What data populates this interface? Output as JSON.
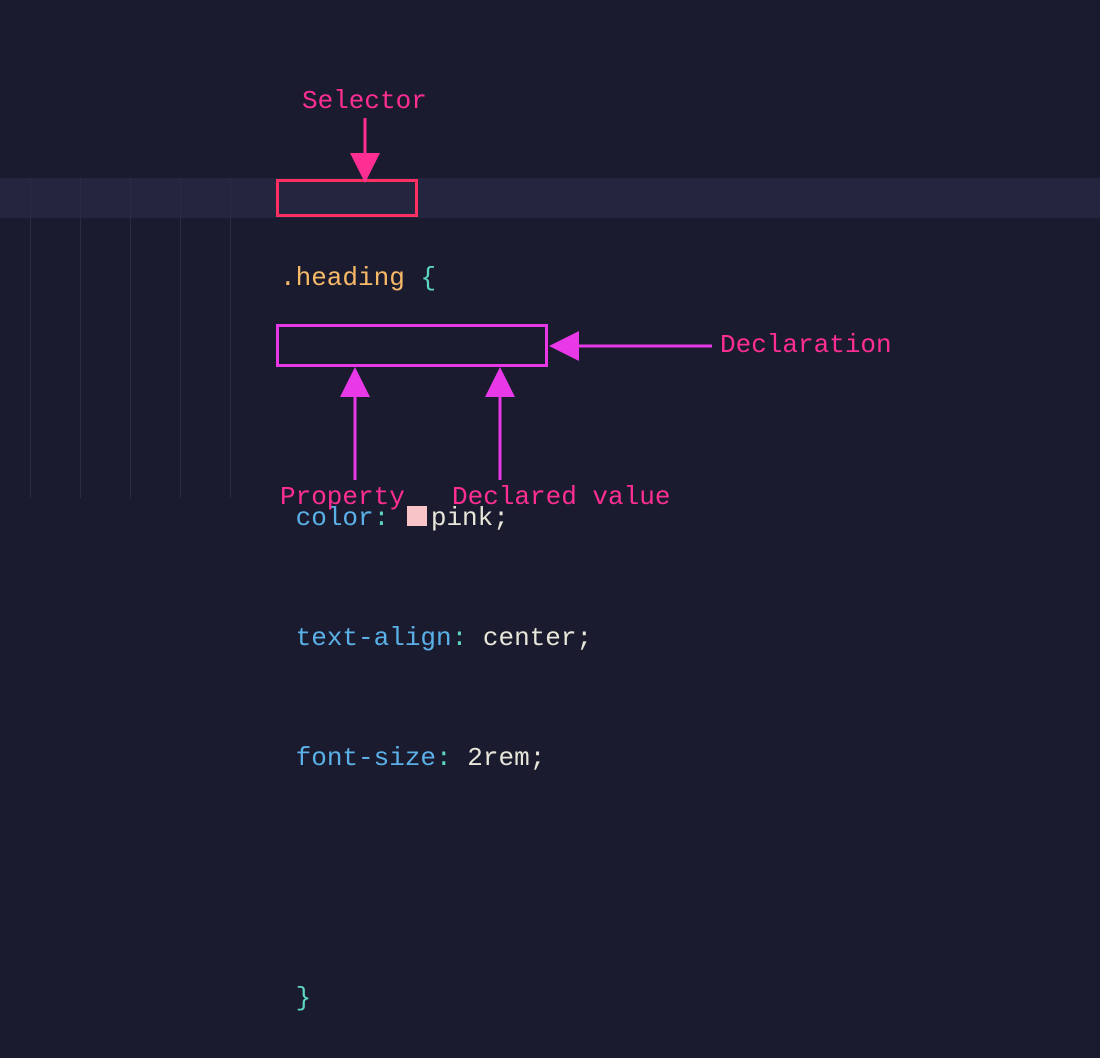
{
  "labels": {
    "selector": "Selector",
    "declaration": "Declaration",
    "property": "Property",
    "declared_value": "Declared value"
  },
  "code": {
    "selector": ".heading",
    "brace_open": "{",
    "brace_close": "}",
    "line1": {
      "prop": "color",
      "colon": ":",
      "value": "pink",
      "semi": ";"
    },
    "line2": {
      "prop": "text-align",
      "colon": ":",
      "value": "center",
      "semi": ";"
    },
    "line3": {
      "prop": "font-size",
      "colon": ":",
      "value": "2rem",
      "semi": ";"
    }
  },
  "colors": {
    "bg": "#1a1b2e",
    "highlight": "#242640",
    "selector_box": "#ff2e63",
    "declaration_box": "#e838e8",
    "label": "#ff2e93",
    "swatch": "#f8c4c7"
  }
}
